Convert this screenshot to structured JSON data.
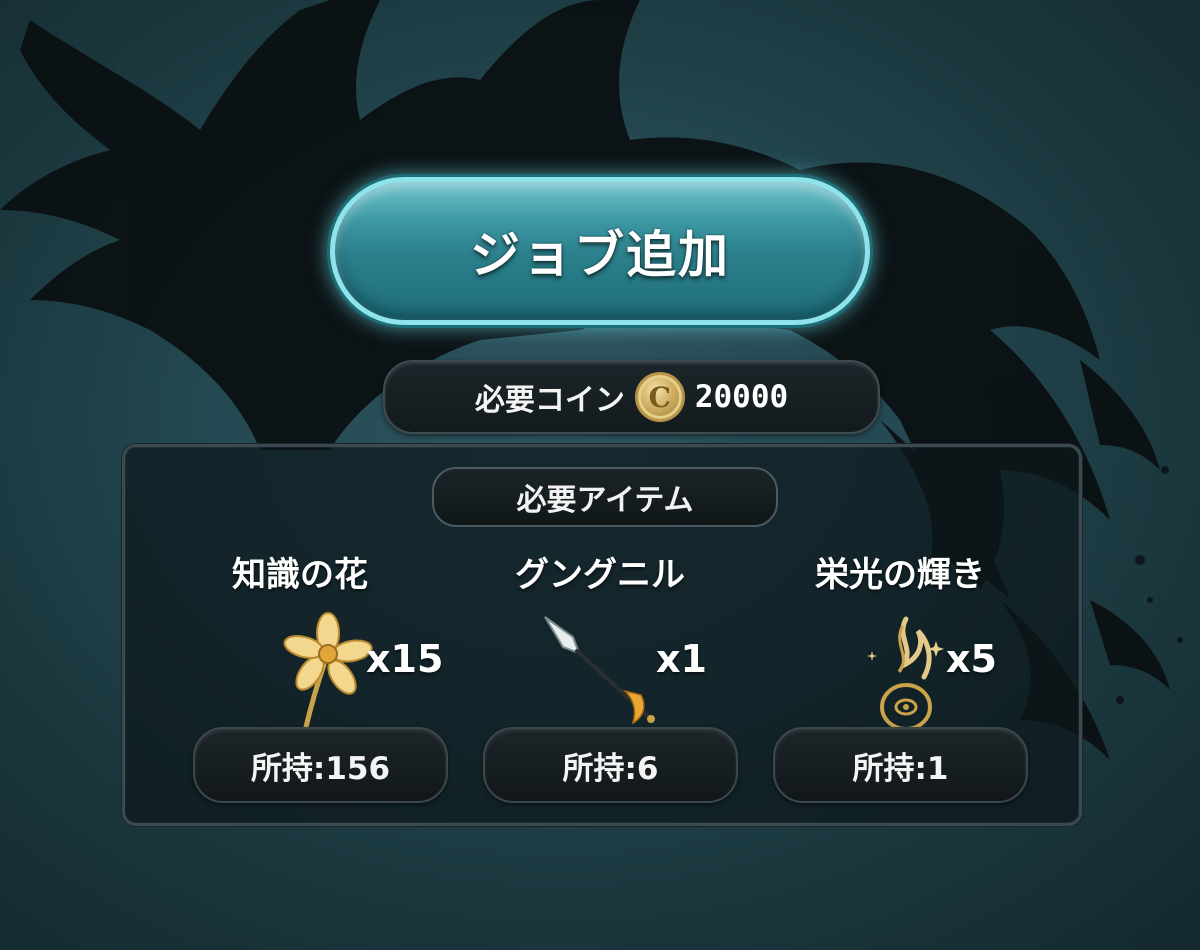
{
  "job_button": {
    "label": "ジョブ追加"
  },
  "coin_requirement": {
    "label": "必要コイン",
    "coin_symbol": "C",
    "value": "20000"
  },
  "items_section": {
    "title": "必要アイテム",
    "items": [
      {
        "name": "知識の花",
        "quantity": "x15",
        "owned": "所持:156",
        "icon": "flower-icon"
      },
      {
        "name": "グングニル",
        "quantity": "x1",
        "owned": "所持:6",
        "icon": "spear-icon"
      },
      {
        "name": "栄光の輝き",
        "quantity": "x5",
        "owned": "所持:1",
        "icon": "flame-icon"
      }
    ]
  },
  "colors": {
    "accent": "#8fe3ea",
    "button": "#2a7f8b",
    "gold": "#cfae62"
  }
}
